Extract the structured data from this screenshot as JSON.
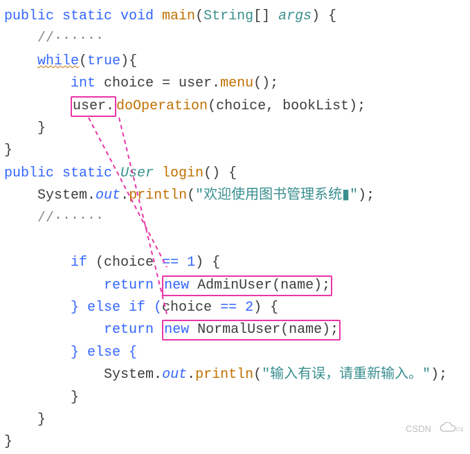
{
  "main": {
    "sig_open": "public static void ",
    "main_name": "main",
    "param_type": "String",
    "args_name": "args",
    "brace_after_sig": ") {",
    "comment": "//······",
    "while_kw": "while",
    "true_kw": "true",
    "choice_decl_int": "int",
    "choice_decl_rest": " choice = user.",
    "menu_fn": "menu",
    "call_close": "();",
    "user_box": "user.",
    "doOp_fn": "doOperation",
    "doOp_args": "(choice, bookList);",
    "brace_close1": "    }",
    "brace_close2": "}"
  },
  "login": {
    "sig_kw": "public static ",
    "ret_type": "User",
    "login_name": " login",
    "sig_close": "() {",
    "sys": "System",
    "out": "out",
    "println": "println",
    "welcome_str": "\"欢迎使用图书管理系统▮\"",
    "stmt_end": ");",
    "comment": "//······",
    "if_kw": "if",
    "choice_var": "choice",
    "eq_op": " == ",
    "one": "1",
    "paren_brace": ") {",
    "return_kw": "return",
    "new_kw": "new",
    "AdminUser": " AdminUser(name);",
    "else_if": "} else if (",
    "two": "2",
    "NormalUser": " NormalUser(name);",
    "else_kw": "} else {",
    "err_str": "\"输入有误，请重新输入。\"",
    "close_inner": "        }",
    "close_mid": "    }",
    "close_outer": "}"
  },
  "wm": {
    "text": "CSDN"
  }
}
